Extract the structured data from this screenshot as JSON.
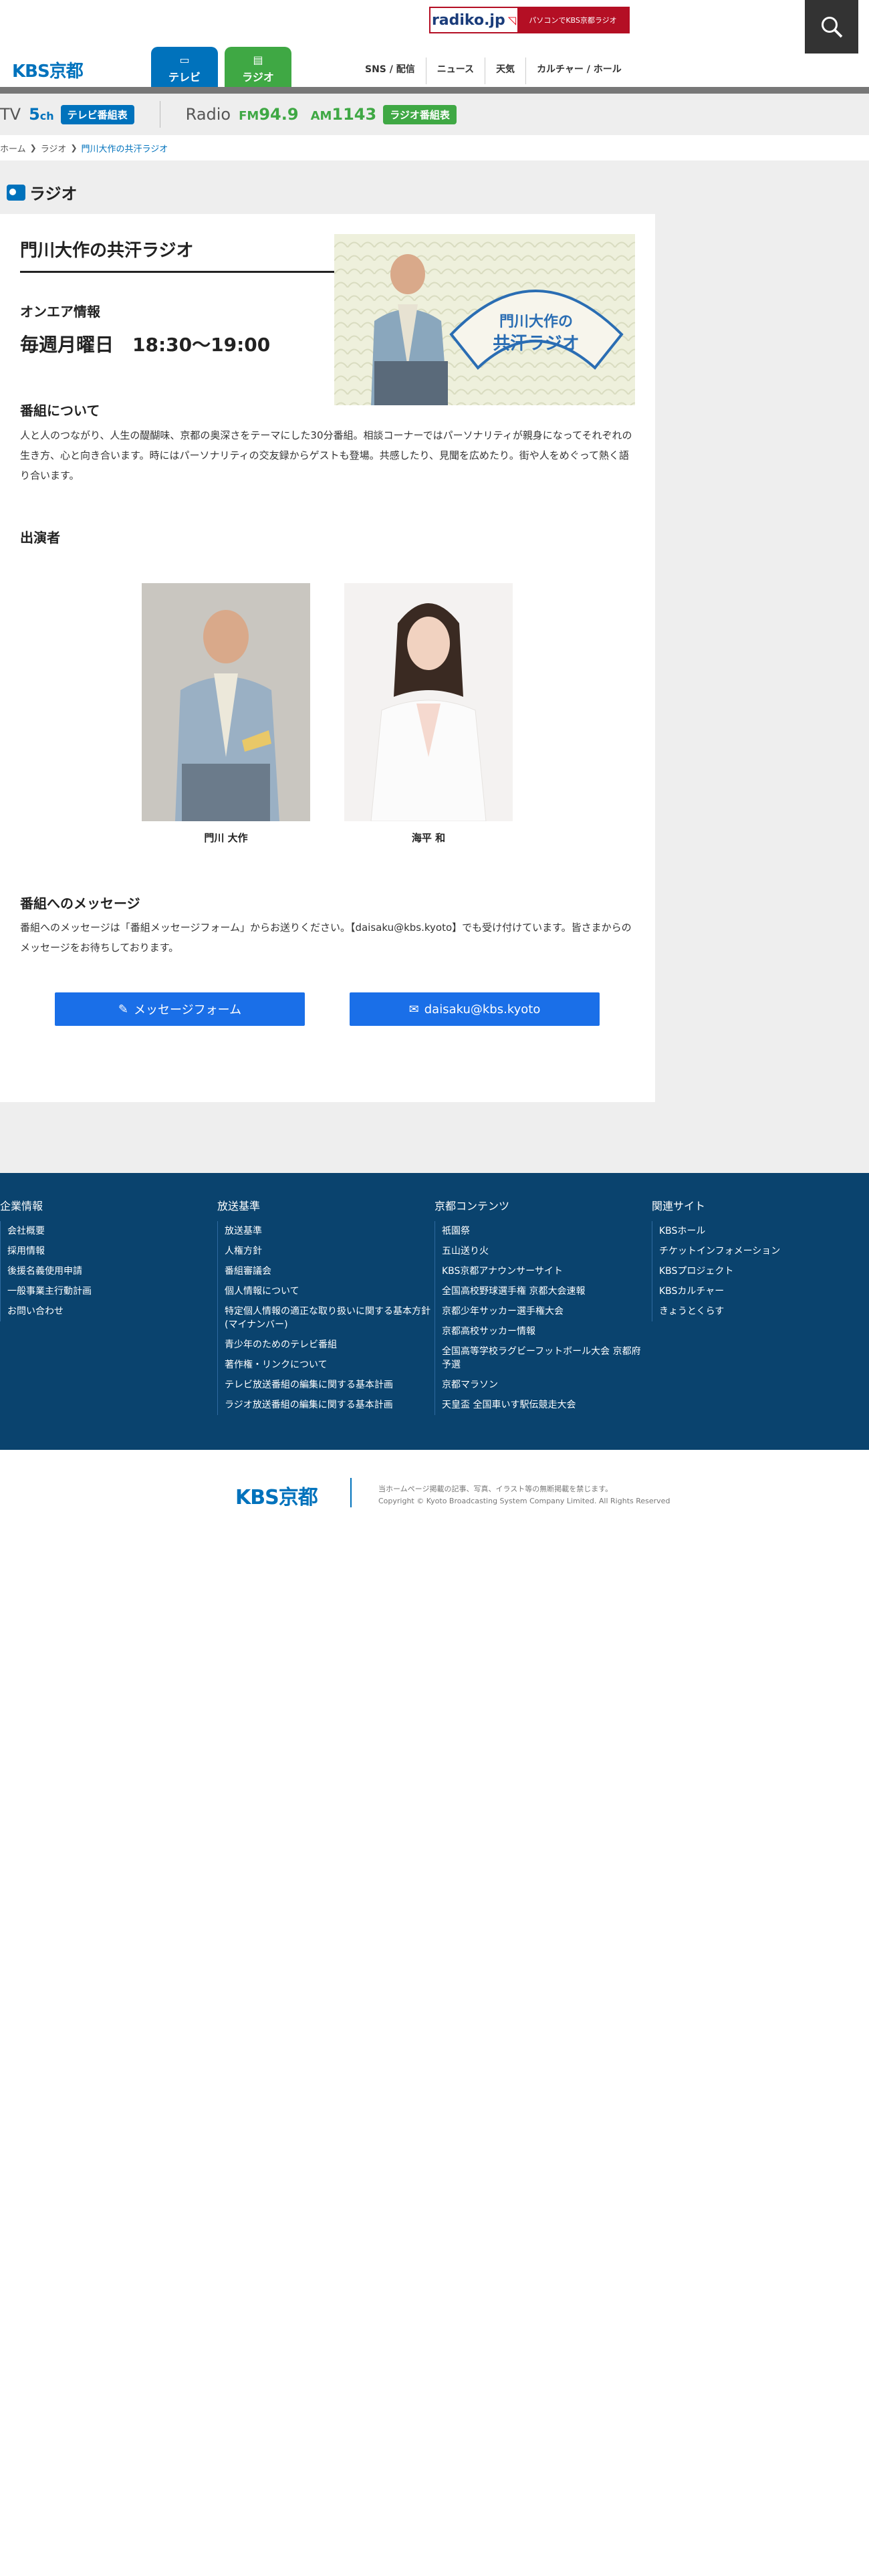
{
  "header": {
    "radiko_logo": "radiko.jp",
    "radiko_text": "パソコンでKBS京都ラジオ",
    "logo": "KBS京都",
    "tabs": [
      {
        "label": "テレビ",
        "icon": "tv-icon"
      },
      {
        "label": "ラジオ",
        "icon": "radio-icon"
      }
    ],
    "nav": [
      "SNS / 配信",
      "ニュース",
      "天気",
      "カルチャー / ホール"
    ]
  },
  "channel_bar": {
    "tv_label": "TV",
    "tv_channel": "5",
    "tv_channel_unit": "ch",
    "tv_badge": "テレビ番組表",
    "radio_label": "Radio",
    "fm_label": "FM",
    "fm_freq": "94.9",
    "am_label": "AM",
    "am_freq": "1143",
    "radio_badge": "ラジオ番組表",
    "tv_color": "#0072bc",
    "radio_color": "#3fa844"
  },
  "breadcrumb": [
    "ホーム",
    "ラジオ",
    "門川大作の共汗ラジオ"
  ],
  "section_title": "ラジオ",
  "program": {
    "title": "門川大作の共汗ラジオ",
    "image_caption_line1": "門川大作の",
    "image_caption_line2": "共汗ラジオ",
    "onair_label": "オンエア情報",
    "onair_time": "毎週月曜日　18:30〜19:00",
    "about_label": "番組について",
    "about_text": "人と人のつながり、人生の醍醐味、京都の奥深さをテーマにした30分番組。相談コーナーではパーソナリティが親身になってそれぞれの生き方、心と向き合います。時にはパーソナリティの交友録からゲストも登場。共感したり、見聞を広めたり。街や人をめぐって熱く語り合います。",
    "cast_label": "出演者",
    "cast": [
      {
        "name": "門川 大作"
      },
      {
        "name": "海平 和"
      }
    ],
    "message_label": "番組へのメッセージ",
    "message_text": "番組へのメッセージは「番組メッセージフォーム」からお送りください。【daisaku@kbs.kyoto】でも受け付けています。皆さまからのメッセージをお待ちしております。",
    "buttons": [
      {
        "label": "メッセージフォーム",
        "icon": "edit-icon"
      },
      {
        "label": "daisaku@kbs.kyoto",
        "icon": "envelope-icon"
      }
    ]
  },
  "footer": {
    "columns": [
      {
        "title": "企業情報",
        "items": [
          "会社概要",
          "採用情報",
          "後援名義使用申請",
          "一般事業主行動計画",
          "お問い合わせ"
        ]
      },
      {
        "title": "放送基準",
        "items": [
          "放送基準",
          "人権方針",
          "番組審議会",
          "個人情報について",
          "特定個人情報の適正な取り扱いに関する基本方針(マイナンバー)",
          "青少年のためのテレビ番組",
          "著作権・リンクについて",
          "テレビ放送番組の編集に関する基本計画",
          "ラジオ放送番組の編集に関する基本計画"
        ]
      },
      {
        "title": "京都コンテンツ",
        "items": [
          "祇園祭",
          "五山送り火",
          "KBS京都アナウンサーサイト",
          "全国高校野球選手権 京都大会速報",
          "京都少年サッカー選手権大会",
          "京都高校サッカー情報",
          "全国高等学校ラグビーフットボール大会 京都府予選",
          "京都マラソン",
          "天皇盃 全国車いす駅伝競走大会"
        ]
      },
      {
        "title": "関連サイト",
        "items": [
          "KBSホール",
          "チケットインフォメーション",
          "KBSプロジェクト",
          "KBSカルチャー",
          "きょうとくらす"
        ]
      }
    ],
    "copy_logo": "KBS京都",
    "copy_line1": "当ホームページ掲載の記事、写真、イラスト等の無断掲載を禁じます。",
    "copy_line2": "Copyright © Kyoto Broadcasting System Company Limited. All Rights Reserved"
  }
}
